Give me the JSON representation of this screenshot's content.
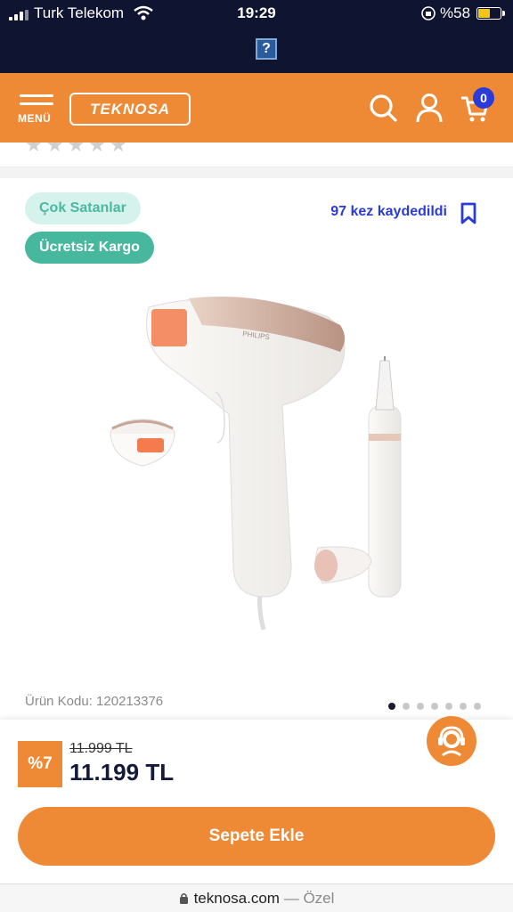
{
  "status_bar": {
    "carrier": "Turk Telekom",
    "time": "19:29",
    "battery": "%58",
    "battery_level": 0.58,
    "placeholder_glyph": "?"
  },
  "header": {
    "menu_label": "MENÜ",
    "logo_text": "TEKNOSA",
    "cart_count": "0",
    "icons": [
      "menu-icon",
      "search-icon",
      "user-icon",
      "cart-icon"
    ]
  },
  "badges": {
    "best_seller": "Çok Satanlar",
    "free_shipping": "Ücretsiz Kargo"
  },
  "saved": {
    "text": "97 kez kaydedildi",
    "icon": "bookmark-icon"
  },
  "product": {
    "code_label": "Ürün Kodu: 120213376",
    "image_brand": "PHILIPS",
    "gallery_count": 7,
    "gallery_active": 1
  },
  "pricing": {
    "discount": "%7",
    "old_price": "11.999 TL",
    "new_price": "11.199 TL"
  },
  "actions": {
    "add_to_cart": "Sepete Ekle",
    "support_icon": "customer-support-icon"
  },
  "browser": {
    "domain": "teknosa.com",
    "separator": "—",
    "mode": "Özel"
  },
  "colors": {
    "brand_orange": "#ee8a36",
    "navy": "#0f1530",
    "accent_blue": "#2b3bd8",
    "teal": "#47b89e"
  }
}
